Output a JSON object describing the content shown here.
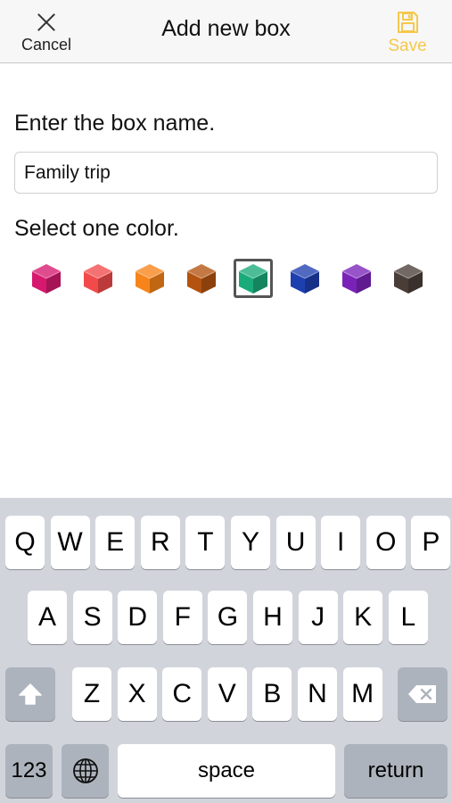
{
  "navbar": {
    "cancel_label": "Cancel",
    "title": "Add new box",
    "save_label": "Save",
    "save_color": "#f5c84b"
  },
  "form": {
    "name_prompt": "Enter the box name.",
    "name_value": "Family trip",
    "color_prompt": "Select one color."
  },
  "colors": {
    "options": [
      {
        "name": "magenta",
        "hex": "#d6196e"
      },
      {
        "name": "red",
        "hex": "#f24a4a"
      },
      {
        "name": "orange",
        "hex": "#f7841a"
      },
      {
        "name": "brown",
        "hex": "#b3530f"
      },
      {
        "name": "green",
        "hex": "#1aab7a"
      },
      {
        "name": "blue",
        "hex": "#1e3fb0"
      },
      {
        "name": "purple",
        "hex": "#7a22b8"
      },
      {
        "name": "dark-brown",
        "hex": "#4a3d38"
      }
    ],
    "selected": "green"
  },
  "keyboard": {
    "row1": [
      "Q",
      "W",
      "E",
      "R",
      "T",
      "Y",
      "U",
      "I",
      "O",
      "P"
    ],
    "row2": [
      "A",
      "S",
      "D",
      "F",
      "G",
      "H",
      "J",
      "K",
      "L"
    ],
    "row3": [
      "Z",
      "X",
      "C",
      "V",
      "B",
      "N",
      "M"
    ],
    "numbers_label": "123",
    "space_label": "space",
    "return_label": "return",
    "icons": {
      "shift": "shift-icon",
      "backspace": "backspace-icon",
      "globe": "globe-icon"
    }
  }
}
